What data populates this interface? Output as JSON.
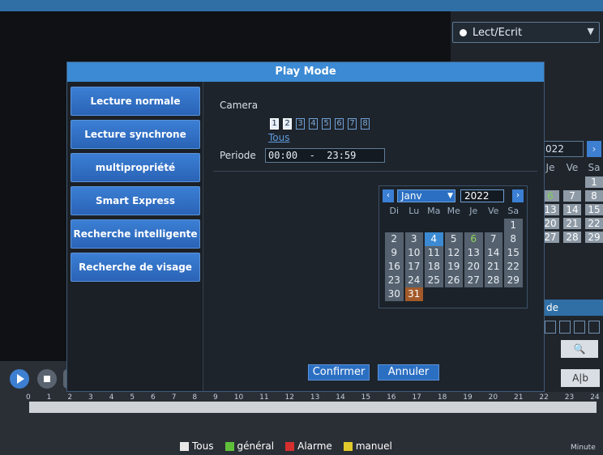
{
  "top_select": {
    "label": "Lect/Ecrit"
  },
  "dialog": {
    "title": "Play Mode",
    "side_items": [
      "Lecture normale",
      "Lecture synchrone",
      "multipropriété",
      "Smart Express",
      "Recherche intelligente",
      "Recherche de visage"
    ],
    "camera_label": "Camera",
    "cameras": [
      "1",
      "2",
      "3",
      "4",
      "5",
      "6",
      "7",
      "8"
    ],
    "selected_cameras": [
      "1",
      "2"
    ],
    "all_link": "Tous",
    "period_label": "Periode",
    "period_value": "00:00  -  23:59",
    "confirm": "Confirmer",
    "cancel": "Annuler"
  },
  "calendar": {
    "month": "Janv",
    "year": "2022",
    "weekdays": [
      "Di",
      "Lu",
      "Ma",
      "Me",
      "Je",
      "Ve",
      "Sa"
    ],
    "weeks": [
      [
        "",
        "",
        "",
        "",
        "",
        "",
        "1"
      ],
      [
        "2",
        "3",
        "4",
        "5",
        "6",
        "7",
        "8"
      ],
      [
        "9",
        "10",
        "11",
        "12",
        "13",
        "14",
        "15"
      ],
      [
        "16",
        "17",
        "18",
        "19",
        "20",
        "21",
        "22"
      ],
      [
        "23",
        "24",
        "25",
        "26",
        "27",
        "28",
        "29"
      ],
      [
        "30",
        "31",
        "",
        "",
        "",
        "",
        ""
      ]
    ],
    "highlighted_day": "4",
    "green_day": "6",
    "current_day": "31"
  },
  "bg_calendar": {
    "year": "022",
    "weekdays": [
      "Je",
      "Ve",
      "Sa"
    ],
    "rows": [
      [
        "",
        "",
        "1"
      ],
      [
        "6",
        "7",
        "8"
      ],
      [
        "13",
        "14",
        "15"
      ],
      [
        "20",
        "21",
        "22"
      ],
      [
        "27",
        "28",
        "29"
      ]
    ]
  },
  "bg_mode_label": "de",
  "bg_ab_label": "A|b",
  "timeline_ticks": [
    "0",
    "1",
    "2",
    "3",
    "4",
    "5",
    "6",
    "7",
    "8",
    "9",
    "10",
    "11",
    "12",
    "13",
    "14",
    "15",
    "16",
    "17",
    "18",
    "19",
    "20",
    "21",
    "22",
    "23",
    "24"
  ],
  "legend": [
    {
      "label": "Tous",
      "color": "#e8e8e8"
    },
    {
      "label": "général",
      "color": "#5fbf3a"
    },
    {
      "label": "Alarme",
      "color": "#d62f2f"
    },
    {
      "label": "manuel",
      "color": "#e0c92a"
    }
  ],
  "corner_label": "Minute"
}
